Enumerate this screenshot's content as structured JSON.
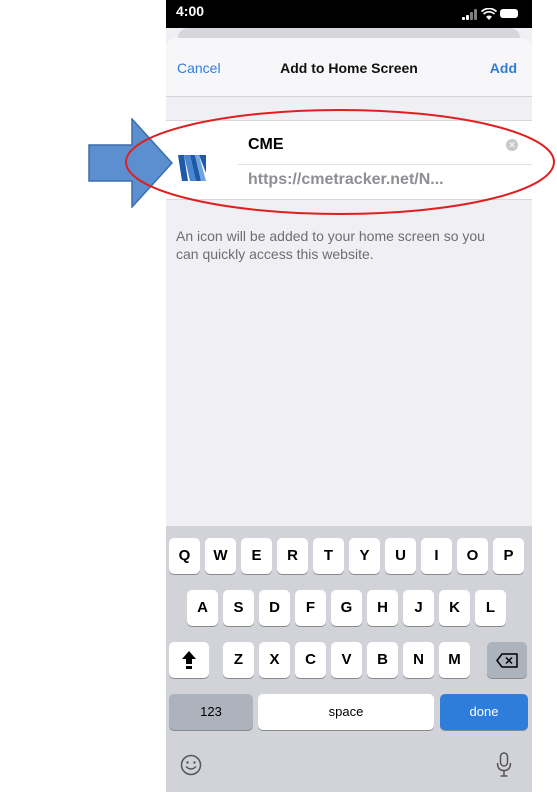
{
  "status_bar": {
    "time": "4:00"
  },
  "nav": {
    "cancel_label": "Cancel",
    "title": "Add to Home Screen",
    "add_label": "Add"
  },
  "form": {
    "name_value": "CME",
    "url_text": "https://cmetracker.net/N..."
  },
  "help_text": "An icon will be added to your home screen so you can quickly access this website.",
  "keyboard": {
    "row1": [
      "Q",
      "W",
      "E",
      "R",
      "T",
      "Y",
      "U",
      "I",
      "O",
      "P"
    ],
    "row2": [
      "A",
      "S",
      "D",
      "F",
      "G",
      "H",
      "J",
      "K",
      "L"
    ],
    "row3": [
      "Z",
      "X",
      "C",
      "V",
      "B",
      "N",
      "M"
    ],
    "numbers_label": "123",
    "space_label": "space",
    "done_label": "done"
  },
  "colors": {
    "ios_blue": "#2f7ddb",
    "annotation_arrow": "#5b8fd0",
    "annotation_ellipse": "#e02020"
  },
  "icons": {
    "app_icon": "cme-logo-icon",
    "clear": "clear-text-icon",
    "shift": "shift-icon",
    "delete": "delete-icon",
    "emoji": "emoji-icon",
    "mic": "microphone-icon"
  }
}
